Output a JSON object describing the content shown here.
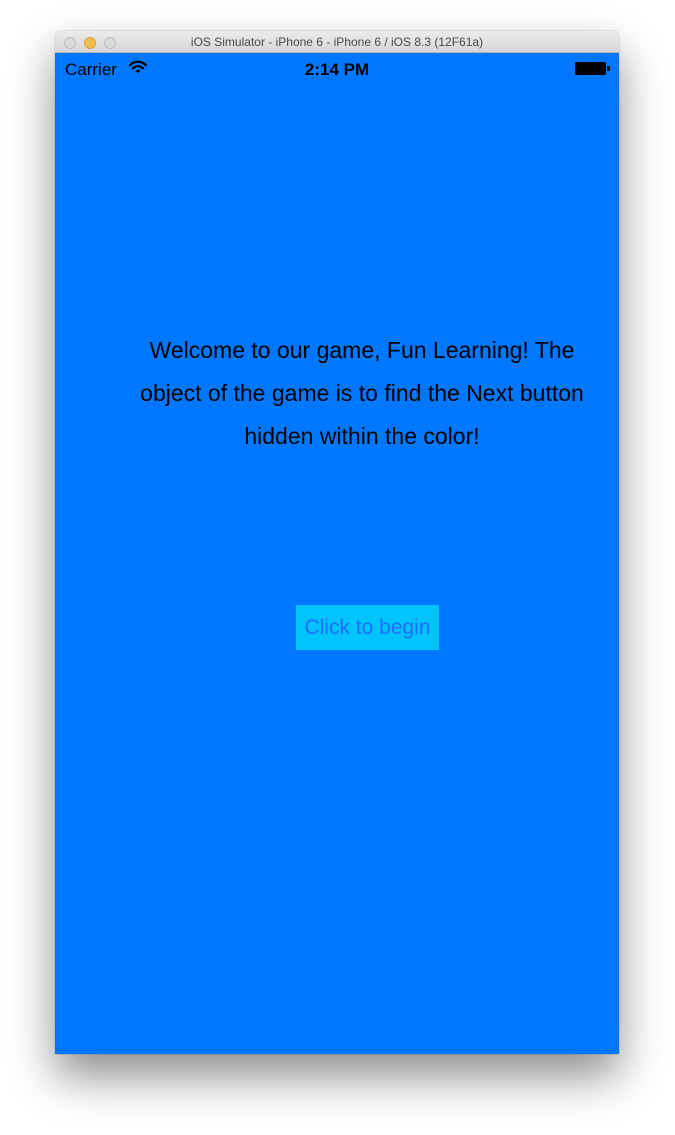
{
  "window": {
    "title": "iOS Simulator - iPhone 6 - iPhone 6 / iOS 8.3 (12F61a)"
  },
  "status_bar": {
    "carrier": "Carrier",
    "time": "2:14 PM",
    "wifi_icon": "wifi-icon",
    "battery_icon": "battery-icon",
    "battery_level": 1.0
  },
  "main": {
    "welcome_text": "Welcome to our game, Fun Learning! The object of the game is to find the Next button hidden within the color!",
    "begin_button_label": "Click to begin"
  },
  "colors": {
    "screen_background": "#0077ff",
    "button_background": "#00c3ff",
    "button_text": "#1f6fff"
  }
}
